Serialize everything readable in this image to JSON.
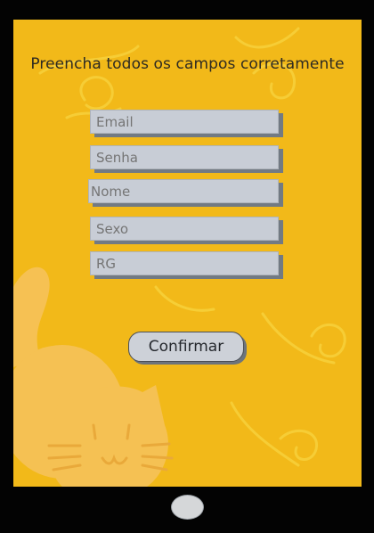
{
  "form": {
    "heading": "Preencha todos os campos corretamente",
    "fields": [
      {
        "placeholder": "Email"
      },
      {
        "placeholder": "Senha"
      },
      {
        "placeholder": "Nome"
      },
      {
        "placeholder": "Sexo"
      },
      {
        "placeholder": "RG"
      }
    ],
    "confirm_label": "Confirmar"
  },
  "colors": {
    "screen_bg": "#f2b919",
    "field_bg": "#c8cdd6",
    "device": "#030303"
  },
  "icons": [
    "cat-illustration",
    "swirl-decoration",
    "home-button"
  ]
}
